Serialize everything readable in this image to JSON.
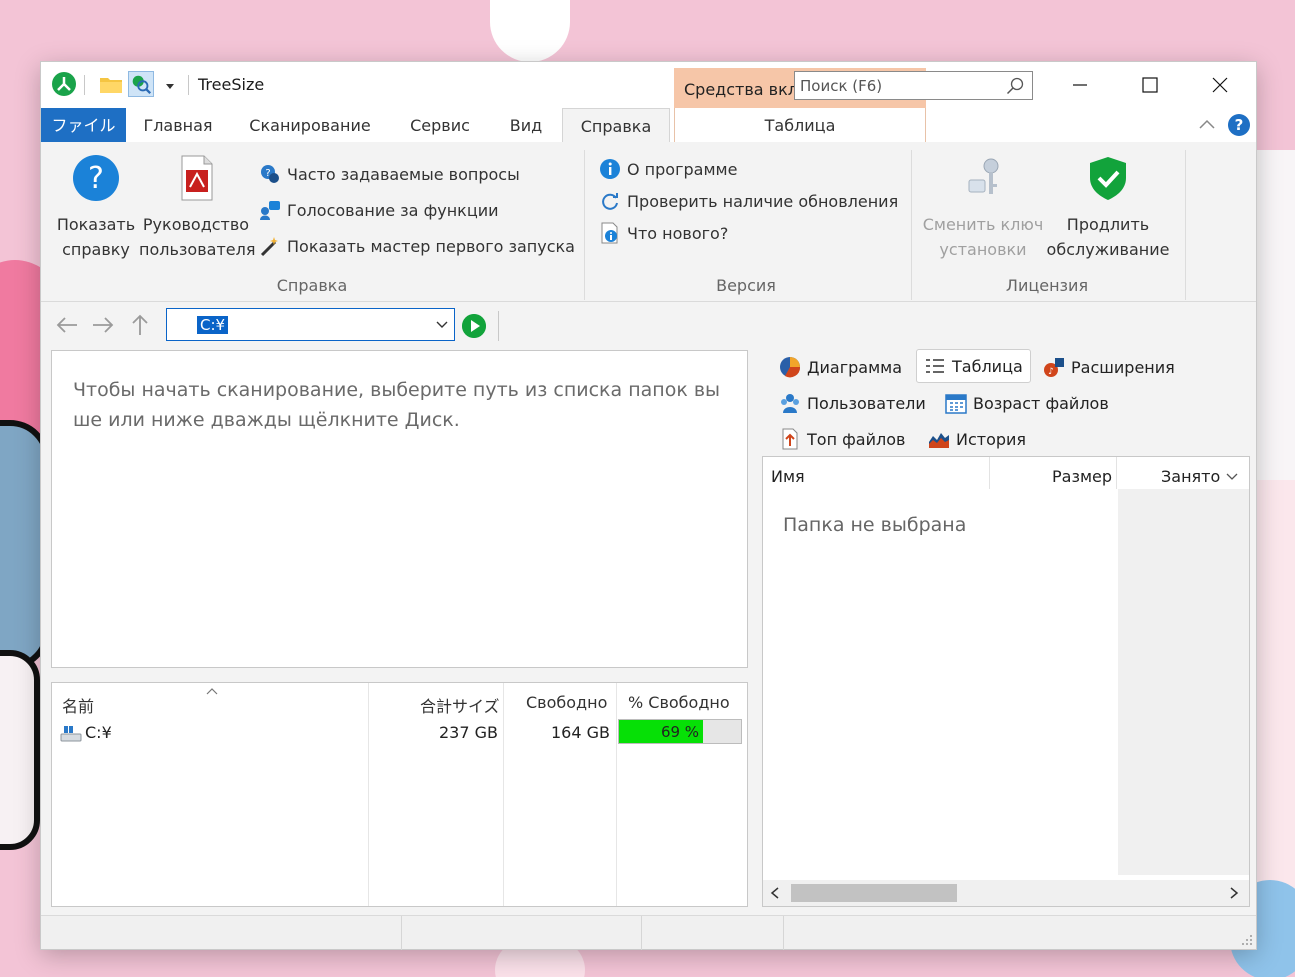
{
  "window": {
    "title": "TreeSize",
    "context_tab_group": "Средства вкл",
    "search_placeholder": "Поиск (F6)"
  },
  "ribbon_tabs": {
    "file": "ファイル",
    "home": "Главная",
    "scan": "Сканирование",
    "service": "Сервис",
    "view": "Вид",
    "help": "Справка",
    "table_context": "Таблица"
  },
  "ribbon": {
    "help_group": {
      "label": "Справка",
      "show_help_line1": "Показать",
      "show_help_line2": "справку",
      "user_guide_line1": "Руководство",
      "user_guide_line2": "пользователя",
      "faq": "Часто задаваемые вопросы",
      "vote": "Голосование за функции",
      "wizard": "Показать мастер первого запуска"
    },
    "version_group": {
      "label": "Версия",
      "about": "О программе",
      "check_updates": "Проверить наличие обновления",
      "whats_new": "Что нового?"
    },
    "license_group": {
      "label": "Лицензия",
      "change_key_line1": "Сменить ключ",
      "change_key_line2": "установки",
      "extend_line1": "Продлить",
      "extend_line2": "обслуживание"
    }
  },
  "navbar": {
    "path": "C:¥"
  },
  "info_panel": {
    "message": "Чтобы начать сканирование, выберите путь из списка папок вы ше или ниже дважды щёлкните Диск."
  },
  "drives": {
    "headers": {
      "name": "名前",
      "total": "合計サイズ",
      "free": "Свободно",
      "percent_free": "% Свободно"
    },
    "rows": [
      {
        "name": "C:¥",
        "total": "237 GB",
        "free": "164 GB",
        "percent_free_label": "69 %",
        "percent_free": 69
      }
    ]
  },
  "view_tabs": {
    "chart": "Диаграмма",
    "table": "Таблица",
    "extensions": "Расширения",
    "users": "Пользователи",
    "file_age": "Возраст файлов",
    "top_files": "Топ файлов",
    "history": "История"
  },
  "right_table": {
    "headers": {
      "name": "Имя",
      "size": "Размер",
      "allocated": "Занято"
    },
    "empty_message": "Папка не выбрана"
  },
  "colors": {
    "accent": "#1e6fc4",
    "context_tab": "#f6c6a8",
    "free_bar": "#06e006",
    "go_button": "#12a33b"
  }
}
